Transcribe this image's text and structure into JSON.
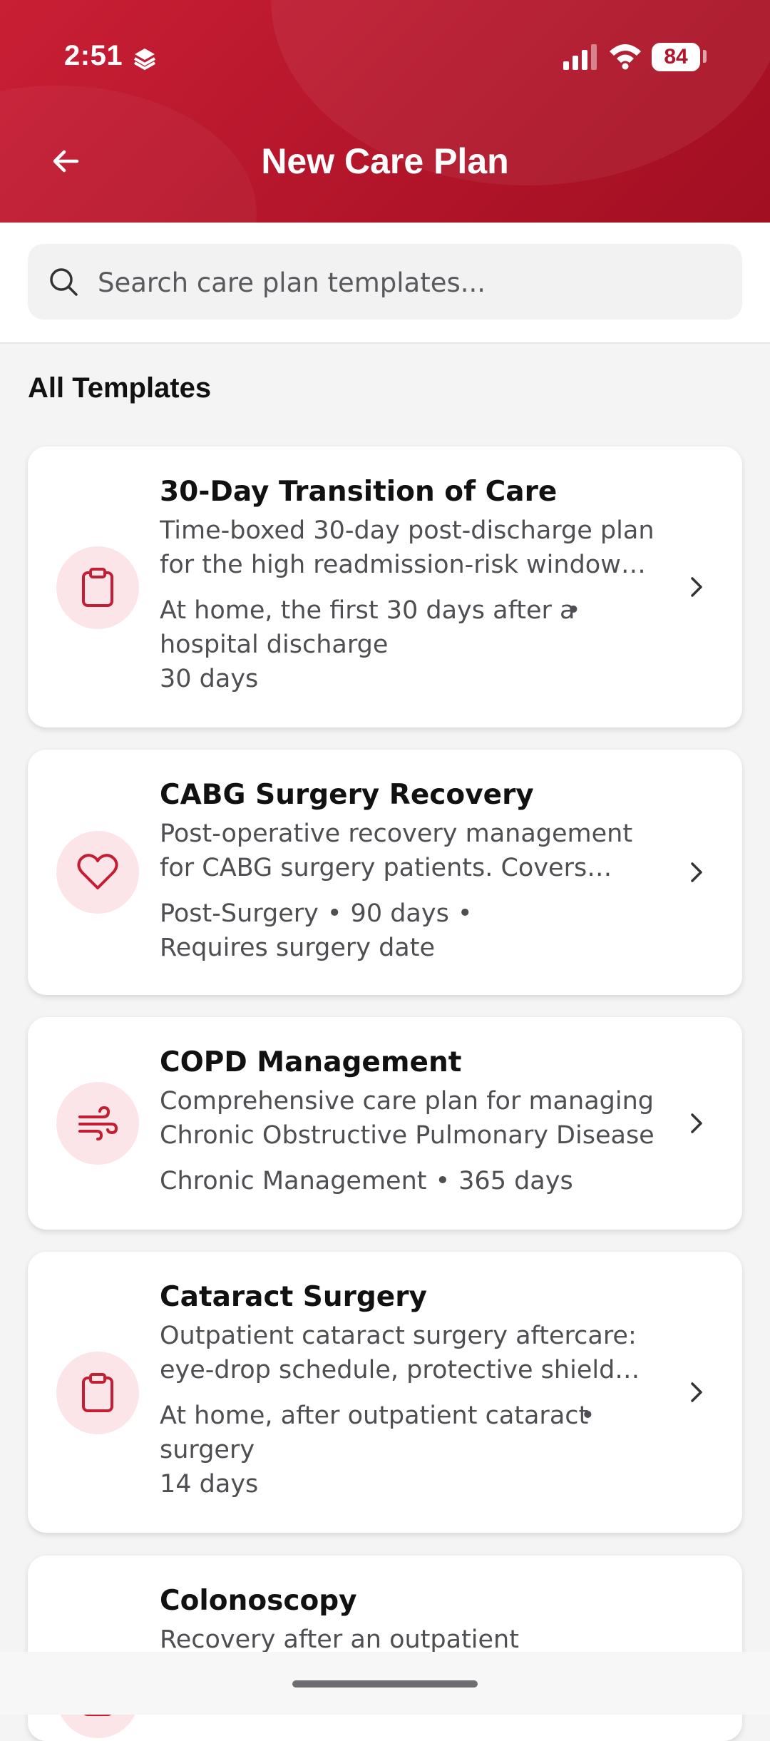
{
  "status_bar": {
    "time": "2:51",
    "battery": "84"
  },
  "header": {
    "title": "New Care Plan"
  },
  "search": {
    "placeholder": "Search care plan templates..."
  },
  "section_title": "All Templates",
  "templates": [
    {
      "title": "30-Day Transition of Care",
      "description": "Time-boxed 30-day post-discharge plan for the high readmission-risk window after a hospital discharge",
      "meta1": "At home, the first 30 days after a hospital discharge",
      "meta2": "30 days",
      "icon": "clipboard-icon"
    },
    {
      "title": "CABG Surgery Recovery",
      "description": "Post-operative recovery management for CABG surgery patients. Covers wound care",
      "meta1": "Post-Surgery",
      "meta2": "90 days",
      "meta3": "Requires surgery date",
      "icon": "heart-icon"
    },
    {
      "title": "COPD Management",
      "description": "Comprehensive care plan for managing Chronic Obstructive Pulmonary Disease",
      "meta1": "Chronic Management",
      "meta2": "365 days",
      "icon": "wind-icon"
    },
    {
      "title": "Cataract Surgery",
      "description": "Outpatient cataract surgery aftercare: eye-drop schedule, protective shield wear",
      "meta1": "At home, after outpatient cataract surgery",
      "meta2": "14 days",
      "icon": "clipboard-icon"
    },
    {
      "title": "Colonoscopy",
      "description": "Recovery after an outpatient",
      "icon": "clipboard-icon"
    }
  ],
  "colors": {
    "primary": "#c41e34",
    "icon_bg": "#fbe5e8"
  }
}
